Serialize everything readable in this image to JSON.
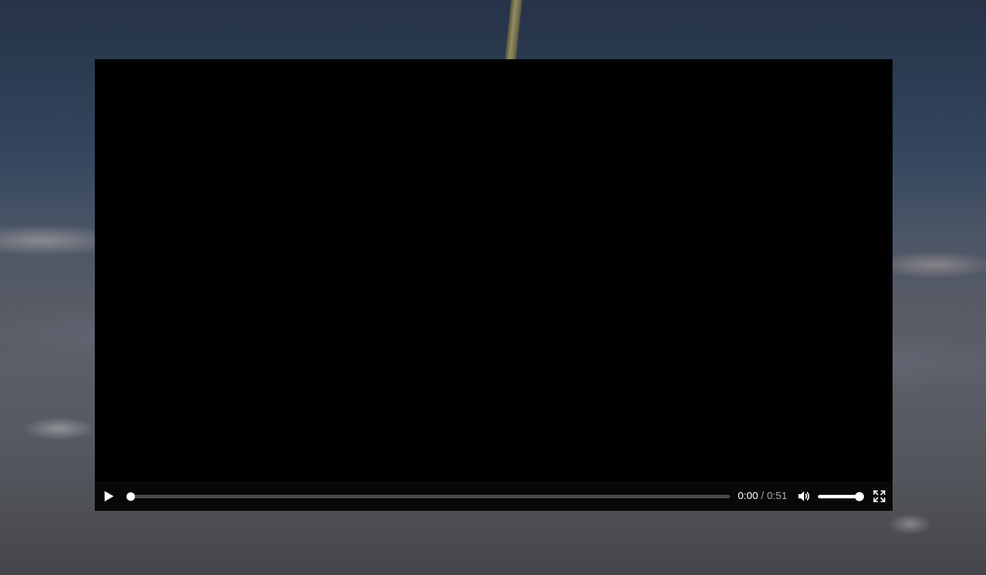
{
  "player": {
    "time_current": "0:00",
    "time_separator": "/",
    "time_duration": "0:51",
    "progress_fraction": 0.0,
    "volume_fraction": 1.0,
    "controls": {
      "play_icon": "play-icon",
      "mute_icon": "volume-icon",
      "fullscreen_icon": "fullscreen-icon"
    }
  },
  "colors": {
    "overlay_bg": "#2d3c52",
    "player_bg": "#000000",
    "controls_bg": "#080808",
    "track": "#4a4a4a",
    "fill": "#ffffff",
    "time_secondary": "#a7a7a7"
  }
}
